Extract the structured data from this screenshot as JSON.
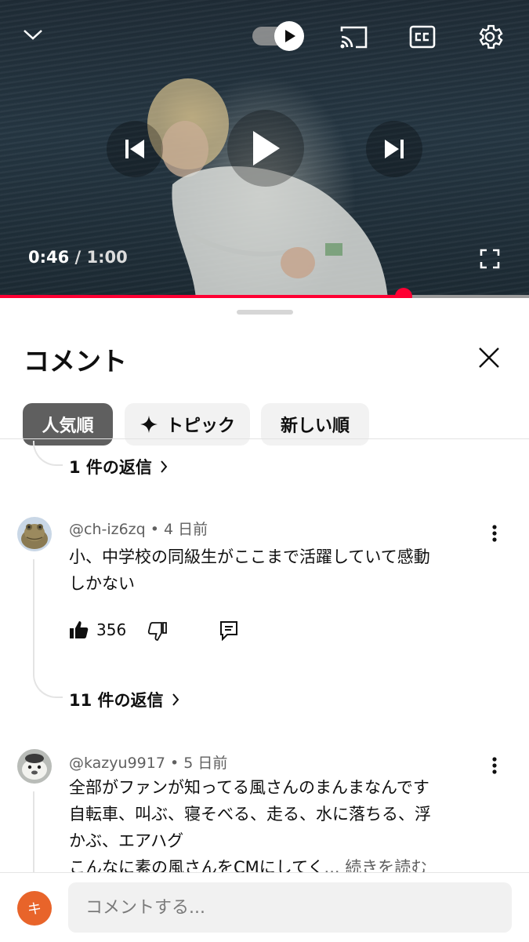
{
  "player": {
    "current_time": "0:46",
    "separator": " / ",
    "duration": "1:00",
    "progress": 0.763,
    "icons": [
      "chevron-down-icon",
      "autoplay-toggle-icon",
      "cast-icon",
      "captions-icon",
      "settings-gear-icon",
      "previous-icon",
      "play-icon",
      "next-icon",
      "fullscreen-icon"
    ],
    "accent_color": "#ff0033"
  },
  "comments_panel": {
    "title": "コメント",
    "close_icon": "close-icon",
    "sort_chips": [
      {
        "label": "人気順",
        "active": true
      },
      {
        "label": "トピック",
        "icon": "sparkle-icon",
        "active": false
      },
      {
        "label": "新しい順",
        "active": false
      }
    ],
    "first_replies_label": "1 件の返信",
    "comments": [
      {
        "author": "@ch-iz6zq",
        "time": "4 日前",
        "text_lines": [
          "小、中学校の同級生がここまで活躍していて感動",
          "しかない"
        ],
        "likes": "356",
        "replies_label": "11 件の返信"
      },
      {
        "author": "@kazyu9917",
        "time": "5 日前",
        "text_lines": [
          "全部がファンが知ってる風さんのまんまなんです",
          "自転車、叫ぶ、寝そべる、走る、水に落ちる、浮",
          "かぶ、エアハグ",
          "こんなに素の風さんをCMにしてく"
        ],
        "read_more": "... 続きを読む"
      }
    ],
    "input": {
      "avatar_letter": "キ",
      "avatar_color": "#e8642a",
      "placeholder": "コメントする..."
    }
  }
}
